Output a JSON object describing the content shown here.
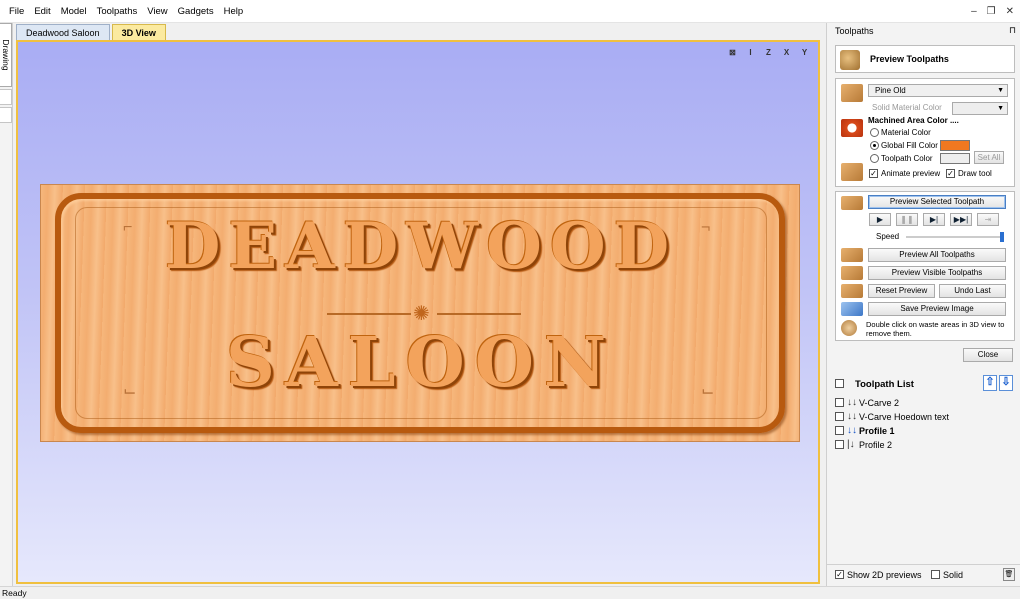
{
  "menu": [
    "File",
    "Edit",
    "Model",
    "Toolpaths",
    "View",
    "Gadgets",
    "Help"
  ],
  "window_controls": {
    "minimize": "–",
    "restore": "❐",
    "close": "✕"
  },
  "left_strip": {
    "drawing_tab": "Drawing"
  },
  "doc_tabs": [
    {
      "label": "Deadwood Saloon",
      "active": false
    },
    {
      "label": "3D View",
      "active": true
    }
  ],
  "view_icons": [
    "⊠",
    "I",
    "Z",
    "X",
    "Y"
  ],
  "sign": {
    "line1": "DEADWOOD",
    "line2": "SALOON"
  },
  "panel": {
    "title": "Toolpaths",
    "pin": "⊓",
    "preview_header": "Preview Toolpaths",
    "material": {
      "selected": "Pine Old",
      "solid_material_color_label": "Solid Material Color",
      "machined_area_label": "Machined Area Color ....",
      "material_color": "Material Color",
      "global_fill_color": "Global Fill Color",
      "toolpath_color": "Toolpath Color",
      "set_all": "Set All",
      "fill_swatch_color": "#f07820",
      "animate_preview": "Animate preview",
      "draw_tool": "Draw tool"
    },
    "controls": {
      "preview_selected": "Preview Selected Toolpath",
      "play": "▶",
      "pause": "❚❚",
      "step": "▶|",
      "fast": "▶▶|",
      "stop": "⇥",
      "speed_label": "Speed",
      "speed_level": 0.98,
      "preview_all": "Preview All Toolpaths",
      "preview_visible": "Preview Visible Toolpaths",
      "reset_preview": "Reset Preview",
      "undo_last": "Undo Last",
      "save_preview_image": "Save Preview Image",
      "hint": "Double click on waste areas in 3D view to remove them."
    },
    "close": "Close",
    "toolpath_list": {
      "title": "Toolpath List",
      "up": "⇧",
      "down": "⇩",
      "items": [
        {
          "name": "V-Carve 2",
          "bold": false,
          "icon": "↓↓"
        },
        {
          "name": "V-Carve Hoedown text",
          "bold": false,
          "icon": "↓↓"
        },
        {
          "name": "Profile 1",
          "bold": true,
          "icon": "↓↓"
        },
        {
          "name": "Profile 2",
          "bold": false,
          "icon": "|↓"
        }
      ]
    },
    "bottom": {
      "show_2d_previews": "Show 2D previews",
      "solid": "Solid",
      "bin": "🗑"
    }
  },
  "status": "Ready"
}
